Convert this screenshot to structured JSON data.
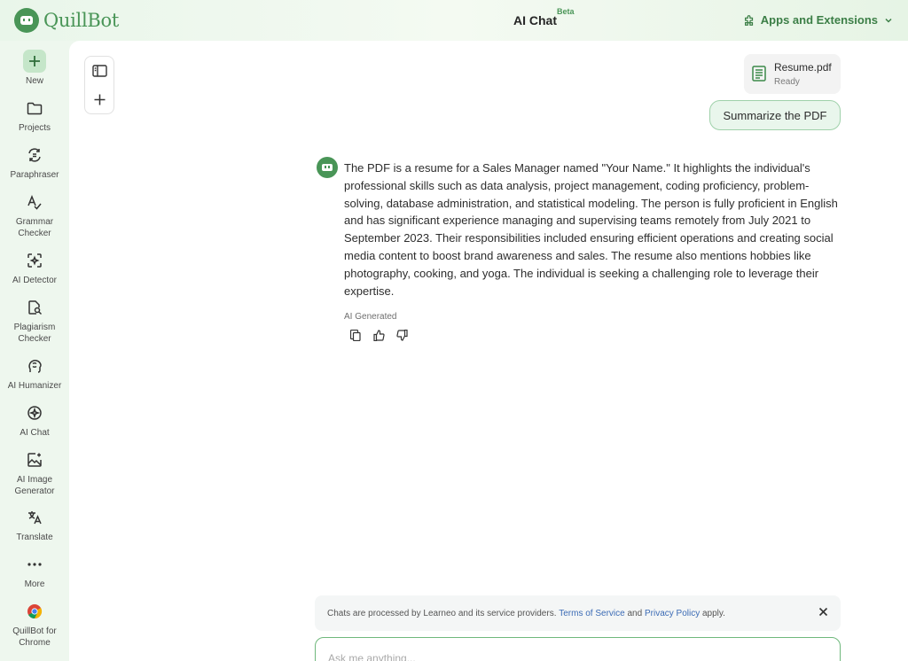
{
  "header": {
    "logo_text": "QuillBot",
    "title": "AI Chat",
    "badge": "Beta",
    "apps_label": "Apps and Extensions"
  },
  "sidebar": {
    "items": [
      {
        "label": "New",
        "icon": "plus-icon"
      },
      {
        "label": "Projects",
        "icon": "folder-icon"
      },
      {
        "label": "Paraphraser",
        "icon": "paraphraser-icon"
      },
      {
        "label": "Grammar Checker",
        "icon": "grammar-icon"
      },
      {
        "label": "AI Detector",
        "icon": "detector-icon"
      },
      {
        "label": "Plagiarism Checker",
        "icon": "plagiarism-icon"
      },
      {
        "label": "AI Humanizer",
        "icon": "humanizer-icon"
      },
      {
        "label": "AI Chat",
        "icon": "chat-icon"
      },
      {
        "label": "AI Image Generator",
        "icon": "image-icon"
      },
      {
        "label": "Translate",
        "icon": "translate-icon"
      },
      {
        "label": "More",
        "icon": "more-icon"
      },
      {
        "label": "QuillBot for Chrome",
        "icon": "chrome-icon"
      }
    ]
  },
  "chat": {
    "file": {
      "name": "Resume.pdf",
      "status": "Ready"
    },
    "user_message": "Summarize the PDF",
    "bot_message": "The PDF is a resume for a Sales Manager named \"Your Name.\" It highlights the individual's professional skills such as data analysis, project management, coding proficiency, problem-solving, database administration, and statistical modeling. The person is fully proficient in English and has significant experience managing and supervising teams remotely from July 2021 to September 2023. Their responsibilities included ensuring efficient operations and creating social media content to boost brand awareness and sales. The resume also mentions hobbies like photography, cooking, and yoga. The individual is seeking a challenging role to leverage their expertise.",
    "ai_generated_label": "AI Generated"
  },
  "notice": {
    "text_before": "Chats are processed by Learneo and its service providers.",
    "terms_link": "Terms of Service",
    "and_text": "and",
    "privacy_link": "Privacy Policy",
    "text_after": "apply."
  },
  "input": {
    "placeholder": "Ask me anything...",
    "value": ""
  },
  "colors": {
    "brand": "#499557",
    "accent_link": "#3b6bb5",
    "user_bubble_bg": "#e9f6ec"
  }
}
